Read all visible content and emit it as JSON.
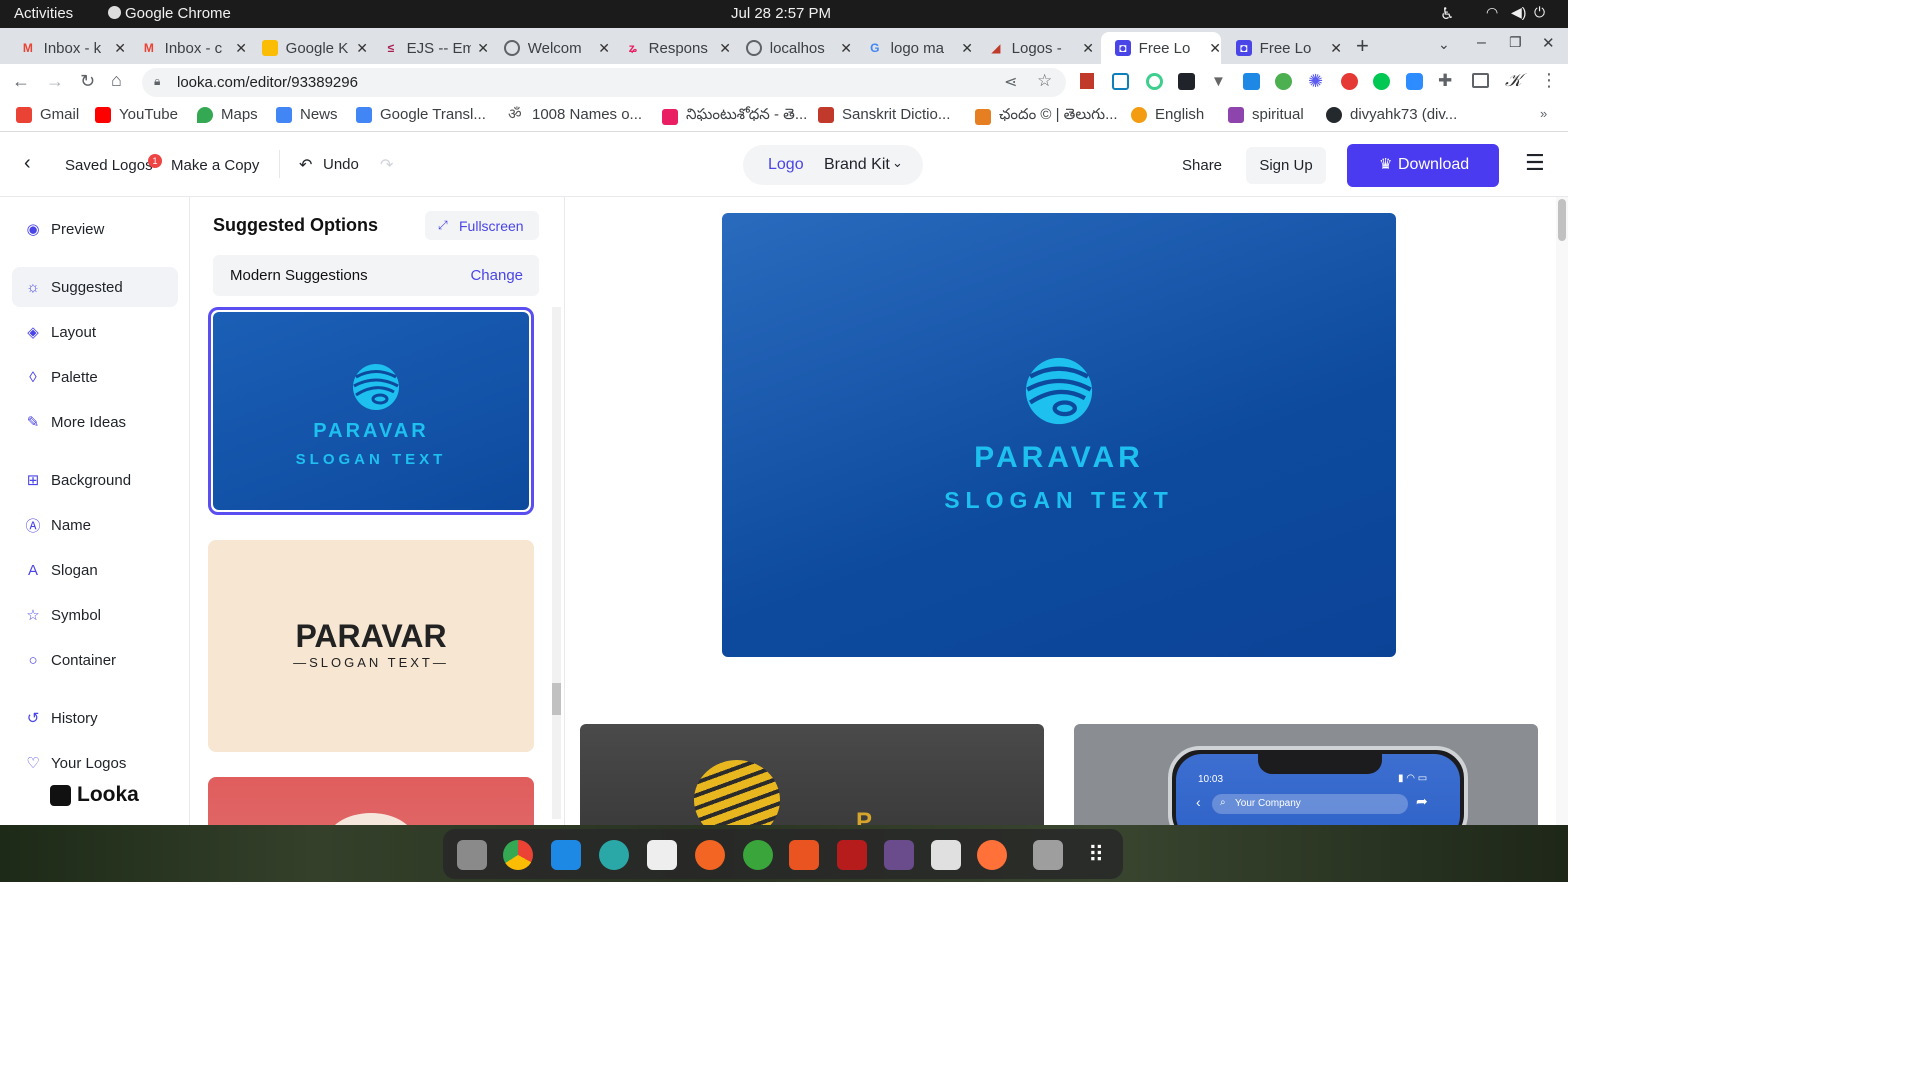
{
  "system": {
    "activities": "Activities",
    "app_name": "Google Chrome",
    "clock": "Jul 28  2:57 PM"
  },
  "tabs": [
    {
      "title": "Inbox - k",
      "icon": "gmail-icon"
    },
    {
      "title": "Inbox - c",
      "icon": "gmail-icon"
    },
    {
      "title": "Google K",
      "icon": "keep-icon"
    },
    {
      "title": "EJS -- Em",
      "icon": "ejs-icon"
    },
    {
      "title": "Welcom",
      "icon": "globe-icon"
    },
    {
      "title": "Respons",
      "icon": "responsive-icon"
    },
    {
      "title": "localhos",
      "icon": "globe-icon"
    },
    {
      "title": "logo ma",
      "icon": "google-icon"
    },
    {
      "title": "Logos -",
      "icon": "logos-icon"
    },
    {
      "title": "Free Lo",
      "icon": "looka-icon"
    },
    {
      "title": "Free Lo",
      "icon": "looka-icon"
    }
  ],
  "address": {
    "url": "looka.com/editor/93389296"
  },
  "bookmarks": [
    {
      "label": "Gmail",
      "color": "#ea4335"
    },
    {
      "label": "YouTube",
      "color": "#ff0000"
    },
    {
      "label": "Maps",
      "color": "#34a853"
    },
    {
      "label": "News",
      "color": "#4285f4"
    },
    {
      "label": "Google Transl...",
      "color": "#4285f4"
    },
    {
      "label": "1008 Names o...",
      "color": "#555555"
    },
    {
      "label": "నిఘంటుశోధన - తె...",
      "color": "#e91e63"
    },
    {
      "label": "Sanskrit Dictio...",
      "color": "#c0392b"
    },
    {
      "label": "ఛందం © | తెలుగు...",
      "color": "#e67e22"
    },
    {
      "label": "Engl‌ish",
      "color": "#f39c12"
    },
    {
      "label": "spiritual",
      "color": "#8e44ad"
    },
    {
      "label": "divyahk73 (div...",
      "color": "#24292e"
    }
  ],
  "header": {
    "saved_logos": "Saved Logos",
    "saved_badge": "1",
    "make_copy": "Make a Copy",
    "undo": "Undo",
    "tab_logo": "Logo",
    "tab_brand_kit": "Brand Kit",
    "share": "Share",
    "sign_up": "Sign Up",
    "download": "Download"
  },
  "nav": [
    {
      "label": "Preview",
      "icon": "eye-icon",
      "glyph": "◉"
    },
    {
      "label": "Suggested",
      "icon": "lightbulb-icon",
      "glyph": "☼"
    },
    {
      "label": "Layout",
      "icon": "layers-icon",
      "glyph": "◈"
    },
    {
      "label": "Palette",
      "icon": "drop-icon",
      "glyph": "◊"
    },
    {
      "label": "More Ideas",
      "icon": "magic-wand-icon",
      "glyph": "✎"
    },
    {
      "label": "Background",
      "icon": "grid-icon",
      "glyph": "⊞"
    },
    {
      "label": "Name",
      "icon": "name-icon",
      "glyph": "Ⓐ"
    },
    {
      "label": "Slogan",
      "icon": "slogan-icon",
      "glyph": "A"
    },
    {
      "label": "Symbol",
      "icon": "star-icon",
      "glyph": "☆"
    },
    {
      "label": "Container",
      "icon": "circle-icon",
      "glyph": "○"
    },
    {
      "label": "History",
      "icon": "history-icon",
      "glyph": "↺"
    },
    {
      "label": "Your Logos",
      "icon": "heart-icon",
      "glyph": "♡"
    }
  ],
  "brand": {
    "name": "Looka"
  },
  "panel": {
    "title": "Suggested Options",
    "fullscreen": "Fullscreen",
    "style_name": "Modern Suggestions",
    "change": "Change"
  },
  "logo": {
    "name": "PARAVAR",
    "slogan": "SLOGAN TEXT",
    "slogan_alt": "SLOGAN TEXT",
    "bg_color": "#0d4a9e",
    "text_color": "#1ec0f0"
  },
  "mockup": {
    "time": "10:03",
    "search": "Your Company"
  }
}
